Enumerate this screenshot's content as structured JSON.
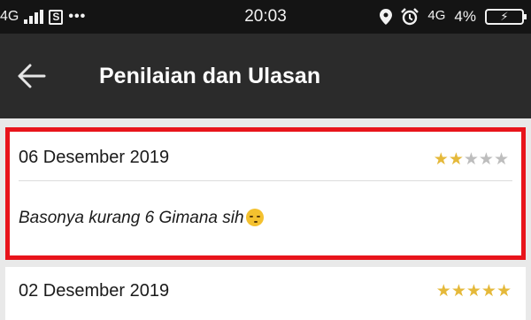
{
  "status_bar": {
    "network_left": "4G",
    "sim_icon": "S",
    "more_dots": "•••",
    "time": "20:03",
    "network_right": "4G",
    "battery_percent": "4%",
    "icons": [
      "signal-icon",
      "sim-icon",
      "location-icon",
      "alarm-icon",
      "battery-icon"
    ]
  },
  "header": {
    "title": "Penilaian dan Ulasan",
    "back_icon": "arrow-left-icon"
  },
  "reviews": [
    {
      "date": "06 Desember 2019",
      "rating": 2,
      "max_rating": 5,
      "text": "Basonya kurang 6 Gimana sih",
      "emoji": "unamused-face",
      "highlighted": true
    },
    {
      "date": "02 Desember 2019",
      "rating": 5,
      "max_rating": 5
    }
  ],
  "colors": {
    "status_bar_bg": "#141414",
    "app_bar_bg": "#2b2b2b",
    "highlight_border": "#e8141b",
    "star_active": "#e5b93a",
    "star_inactive": "#bdbdbd",
    "page_bg": "#e9e9e9"
  }
}
